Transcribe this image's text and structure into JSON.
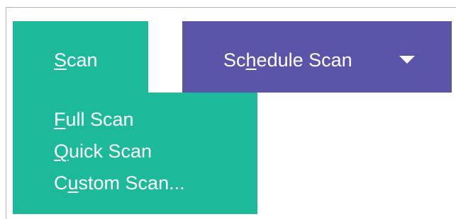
{
  "scan_button": {
    "mnemonic": "S",
    "rest": "can"
  },
  "schedule_button": {
    "before": "Sc",
    "mnemonic": "h",
    "after": "edule Scan",
    "caret_icon": "caret-down-icon"
  },
  "menu": {
    "items": [
      {
        "before": "",
        "mnemonic": "F",
        "after": "ull Scan"
      },
      {
        "before": "",
        "mnemonic": "Q",
        "after": "uick Scan"
      },
      {
        "before": "C",
        "mnemonic": "u",
        "after": "stom Scan..."
      }
    ]
  },
  "colors": {
    "scan_green": "#1db99b",
    "schedule_purple": "#5a55a8",
    "text": "#ffffff"
  }
}
